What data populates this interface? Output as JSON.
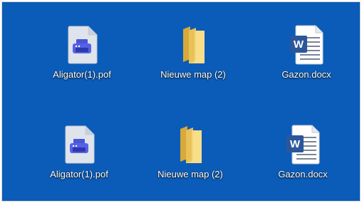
{
  "desktop": {
    "background_color": "#0b5cb8",
    "icons": [
      {
        "label": "Aligator(1).pof",
        "icon": "printer-file-icon"
      },
      {
        "label": "Nieuwe map (2)",
        "icon": "folder-icon"
      },
      {
        "label": "Gazon.docx",
        "icon": "word-document-icon"
      },
      {
        "label": "Aligator(1).pof",
        "icon": "printer-file-icon"
      },
      {
        "label": "Nieuwe map (2)",
        "icon": "folder-icon"
      },
      {
        "label": "Gazon.docx",
        "icon": "word-document-icon"
      }
    ]
  }
}
